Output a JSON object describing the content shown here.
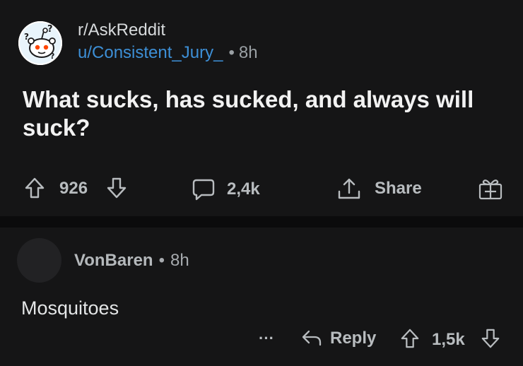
{
  "post": {
    "subreddit": "r/AskReddit",
    "author": "u/Consistent_Jury_",
    "dot": "•",
    "age": "8h",
    "title": "What sucks, has sucked, and always will suck?",
    "votes": "926",
    "comments": "2,4k",
    "share_label": "Share"
  },
  "comment": {
    "author": "VonBaren",
    "dot": "•",
    "age": "8h",
    "body": "Mosquitoes",
    "more": "···",
    "reply_label": "Reply",
    "votes": "1,5k"
  },
  "colors": {
    "background": "#151516",
    "username_link": "#3d8fd6",
    "muted_text": "#9aa0a4"
  }
}
